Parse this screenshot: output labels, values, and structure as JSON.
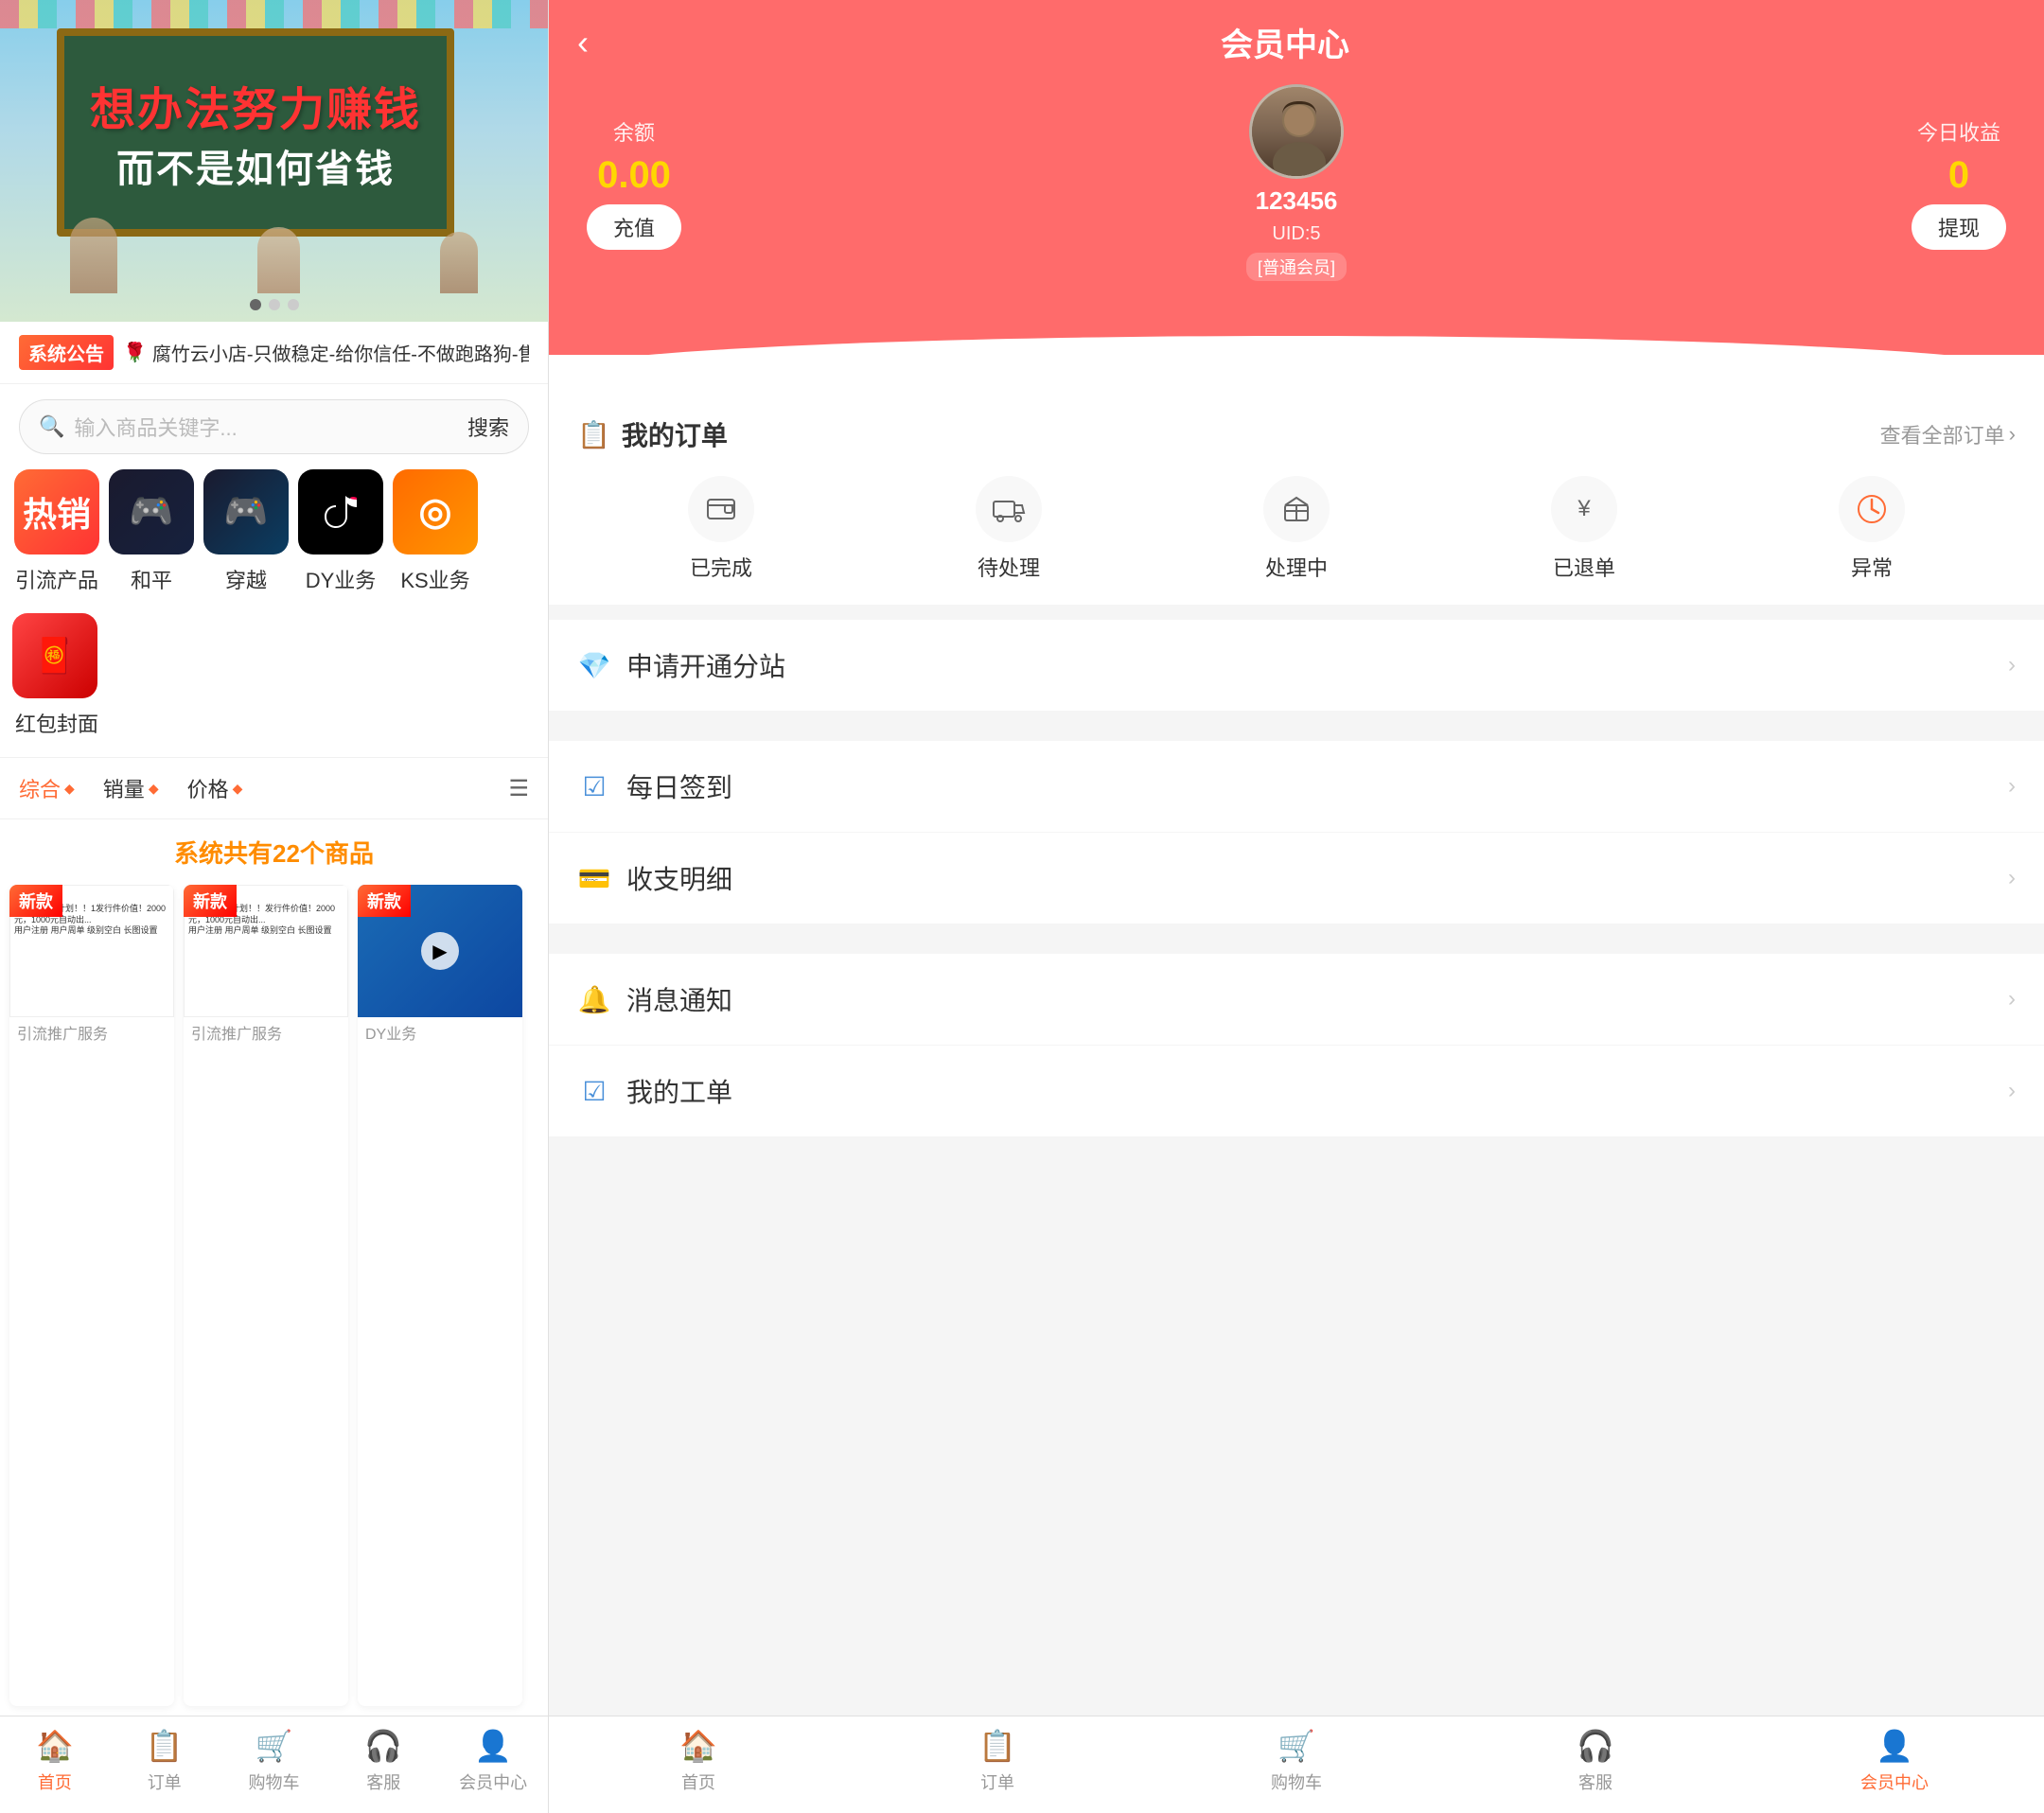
{
  "left": {
    "banner": {
      "line1": "想办法努力赚钱",
      "line2": "而不是如何省钱",
      "dots": [
        true,
        false,
        false
      ]
    },
    "announcement": {
      "label": "系统公告",
      "text": "🌹腐竹云小店-只做稳定-给你信任-不做跑路狗-售后稳定🌹"
    },
    "search": {
      "placeholder": "输入商品关键字...",
      "button": "搜索"
    },
    "categories": [
      {
        "id": "hot",
        "label": "引流产品",
        "icon": "🔥",
        "bg": "hot"
      },
      {
        "id": "heping",
        "label": "和平",
        "icon": "🎮",
        "bg": "heping"
      },
      {
        "id": "chuyue",
        "label": "穿越",
        "icon": "🎮",
        "bg": "chuyue"
      },
      {
        "id": "dy",
        "label": "DY业务",
        "icon": "♪",
        "bg": "dy"
      },
      {
        "id": "ks",
        "label": "KS业务",
        "icon": "◎",
        "bg": "ks"
      }
    ],
    "extraCategory": {
      "id": "redpacket",
      "label": "红包封面",
      "icon": "🧧"
    },
    "sort": {
      "items": [
        "综合",
        "销量",
        "价格"
      ],
      "activeIndex": 0
    },
    "productCount": "系统共有22个商品",
    "products": [
      {
        "id": 1,
        "isNew": true
      },
      {
        "id": 2,
        "isNew": true
      },
      {
        "id": 3,
        "isNew": true
      }
    ],
    "bottomNav": [
      {
        "id": "home",
        "label": "首页",
        "icon": "🏠",
        "active": true
      },
      {
        "id": "order",
        "label": "订单",
        "icon": "📋",
        "active": false
      },
      {
        "id": "cart",
        "label": "购物车",
        "icon": "🛒",
        "active": false
      },
      {
        "id": "service",
        "label": "客服",
        "icon": "🎧",
        "active": false
      },
      {
        "id": "member",
        "label": "会员中心",
        "icon": "👤",
        "active": false
      }
    ]
  },
  "right": {
    "header": {
      "back": "‹",
      "title": "会员中心",
      "balance": {
        "label": "余额",
        "amount": "0.00",
        "button": "充值"
      },
      "profile": {
        "username": "123456",
        "uid": "UID:5",
        "memberType": "[普通会员]"
      },
      "earnings": {
        "label": "今日收益",
        "amount": "0",
        "button": "提现"
      }
    },
    "orders": {
      "title": "我的订单",
      "viewAll": "查看全部订单",
      "statuses": [
        {
          "id": "completed",
          "label": "已完成",
          "icon": "💳"
        },
        {
          "id": "pending",
          "label": "待处理",
          "icon": "🚚"
        },
        {
          "id": "processing",
          "label": "处理中",
          "icon": "📦"
        },
        {
          "id": "cancelled",
          "label": "已退单",
          "icon": "¥"
        },
        {
          "id": "abnormal",
          "label": "异常",
          "icon": "⏱"
        }
      ]
    },
    "menu": [
      {
        "id": "substation",
        "label": "申请开通分站",
        "icon": "💎",
        "iconClass": "purple"
      },
      {
        "id": "checkin",
        "label": "每日签到",
        "icon": "✅",
        "iconClass": "blue"
      },
      {
        "id": "finance",
        "label": "收支明细",
        "icon": "💳",
        "iconClass": "orange"
      },
      {
        "id": "notification",
        "label": "消息通知",
        "icon": "🔔",
        "iconClass": "orange"
      },
      {
        "id": "worklist",
        "label": "我的工单",
        "icon": "✅",
        "iconClass": "blue"
      }
    ],
    "bottomNav": [
      {
        "id": "home",
        "label": "首页",
        "icon": "🏠",
        "active": false
      },
      {
        "id": "order",
        "label": "订单",
        "icon": "📋",
        "active": false
      },
      {
        "id": "cart",
        "label": "购物车",
        "icon": "🛒",
        "active": false
      },
      {
        "id": "service",
        "label": "客服",
        "icon": "🎧",
        "active": false
      },
      {
        "id": "member",
        "label": "会员中心",
        "icon": "👤",
        "active": true
      }
    ]
  }
}
